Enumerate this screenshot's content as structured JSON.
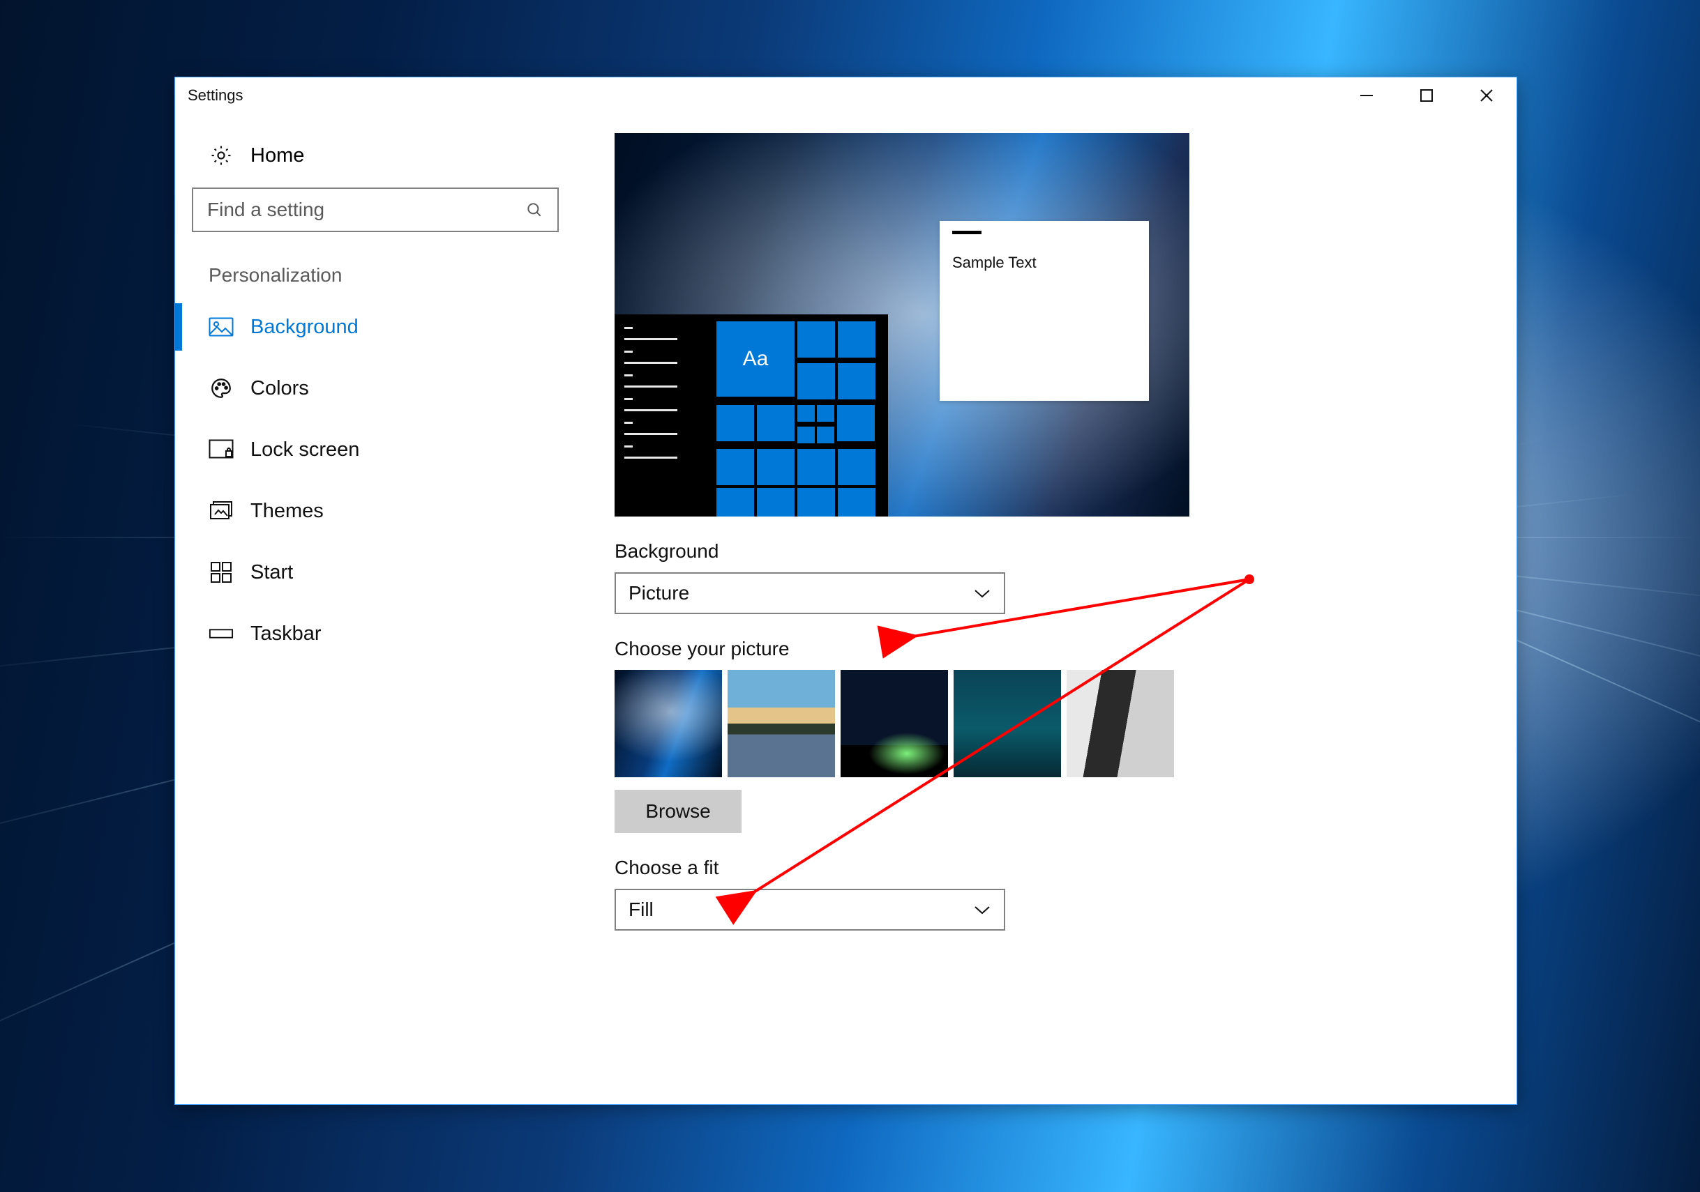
{
  "window": {
    "title": "Settings"
  },
  "sidebar": {
    "home": "Home",
    "search_placeholder": "Find a setting",
    "category": "Personalization",
    "items": [
      {
        "label": "Background",
        "active": true
      },
      {
        "label": "Colors"
      },
      {
        "label": "Lock screen"
      },
      {
        "label": "Themes"
      },
      {
        "label": "Start"
      },
      {
        "label": "Taskbar"
      }
    ]
  },
  "preview": {
    "tile_text": "Aa",
    "note_text": "Sample Text"
  },
  "main": {
    "background_label": "Background",
    "background_value": "Picture",
    "choose_picture_label": "Choose your picture",
    "browse_label": "Browse",
    "fit_label": "Choose a fit",
    "fit_value": "Fill"
  },
  "annotation": {
    "color": "#ff0000"
  }
}
